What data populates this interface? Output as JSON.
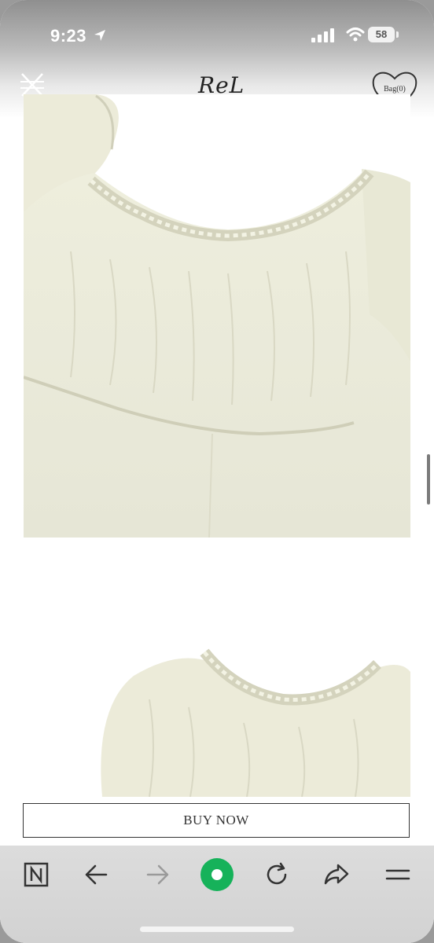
{
  "status_bar": {
    "time": "9:23",
    "battery": "58"
  },
  "site": {
    "logo": "ReL",
    "bag_label": "Bag(0)"
  },
  "product": {
    "buy_button": "BUY NOW"
  },
  "browser_toolbar": {
    "buttons": [
      "naver-home",
      "back",
      "forward",
      "green-dot-home",
      "reload",
      "share",
      "menu"
    ]
  }
}
